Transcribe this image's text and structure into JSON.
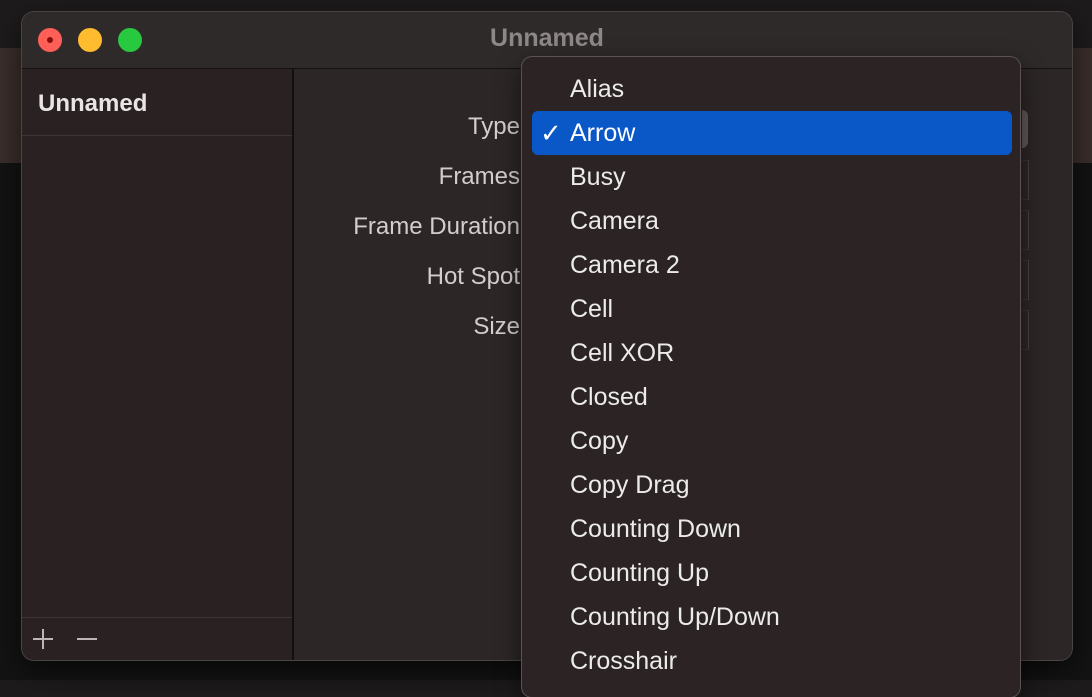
{
  "window": {
    "title": "Unnamed"
  },
  "sidebar": {
    "items": [
      {
        "label": "Unnamed",
        "selected": true
      }
    ],
    "footer": {
      "add_icon": "plus-icon",
      "remove_icon": "minus-icon"
    }
  },
  "form": {
    "type_label": "Type",
    "frames_label": "Frames",
    "frame_duration_label": "Frame Duration",
    "hot_spot_label": "Hot Spot",
    "size_label": "Size"
  },
  "menu": {
    "selected": "Arrow",
    "check_icon": "checkmark-icon",
    "items": [
      "Alias",
      "Arrow",
      "Busy",
      "Camera",
      "Camera 2",
      "Cell",
      "Cell XOR",
      "Closed",
      "Copy",
      "Copy Drag",
      "Counting Down",
      "Counting Up",
      "Counting Up/Down",
      "Crosshair"
    ]
  },
  "colors": {
    "selection": "#0a57c8",
    "close": "#ff5f57",
    "minimize": "#febc2e",
    "zoom": "#28c840"
  }
}
